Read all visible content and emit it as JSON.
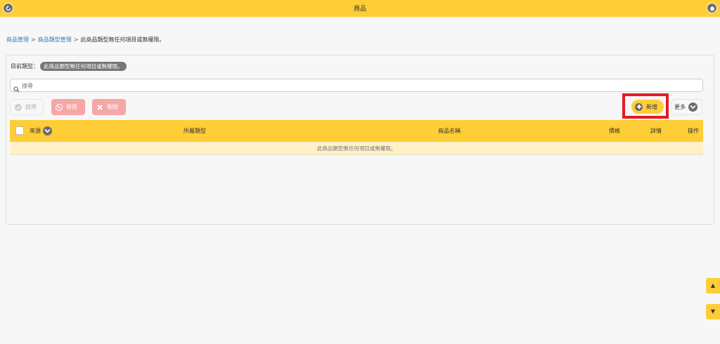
{
  "header": {
    "title": "商品",
    "back_icon": "back-arrow-icon",
    "home_icon": "home-icon"
  },
  "breadcrumb": {
    "items": [
      "商品管理",
      "商品類型管理"
    ],
    "separator": ">",
    "current": "此商品類型無任何項目或無權限。"
  },
  "panel": {
    "current_type_label": "目前類型：",
    "current_type_value": "此商品類型無任何項目或無權限。"
  },
  "search": {
    "value": "",
    "placeholder": "搜尋"
  },
  "toolbar": {
    "enable_label": "啟用",
    "disable_label": "停用",
    "delete_label": "刪除",
    "add_label": "新增",
    "more_label": "更多"
  },
  "table": {
    "columns": [
      "來源",
      "所屬類型",
      "商品名稱",
      "價格",
      "詳情",
      "操作"
    ],
    "empty_message": "此商品類型無任何項目或無權限。"
  },
  "scroll": {
    "up": "▲",
    "down": "▼"
  },
  "colors": {
    "accent": "#ffcd36",
    "highlight": "#e31b23",
    "danger_light": "#f7a6a6",
    "link": "#2f7fc1"
  }
}
